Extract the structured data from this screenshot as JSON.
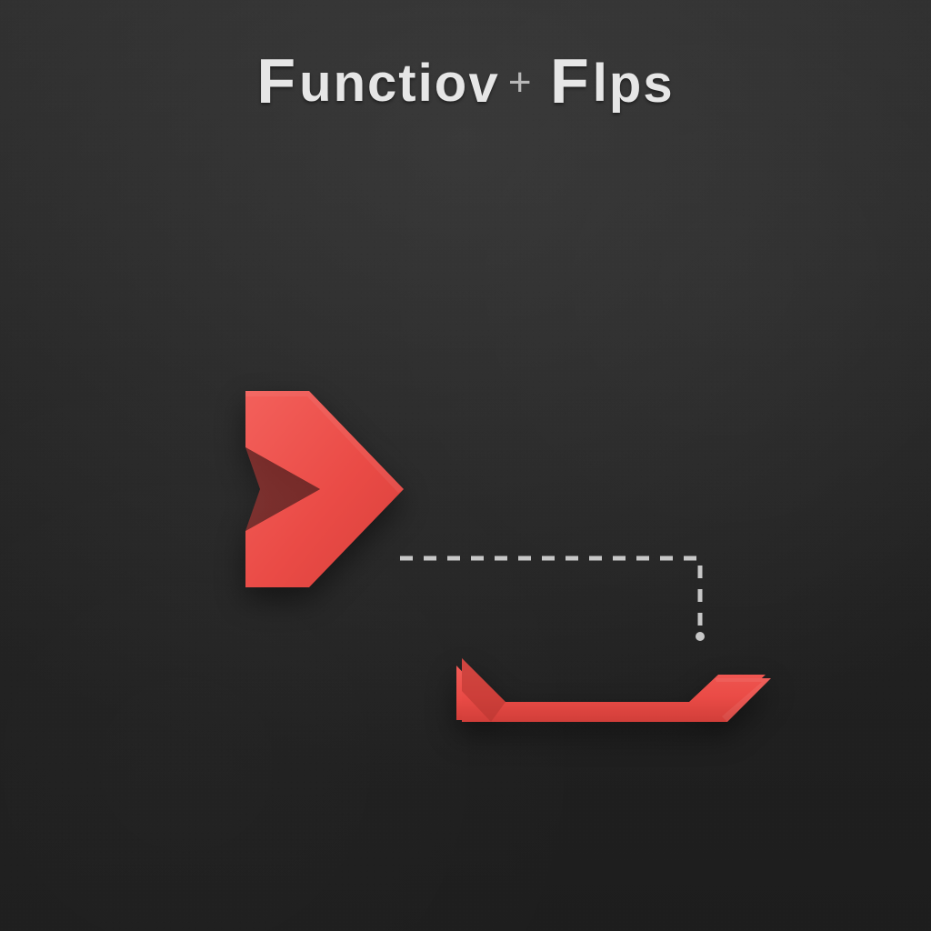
{
  "title": {
    "word1_rest": "unctio",
    "word1_tail": "v",
    "word2_rest": "l",
    "word2_tail": "ps"
  },
  "colors": {
    "accent": "#ea4b46",
    "accent_highlight": "#f3605b",
    "accent_shadow": "#c23b36",
    "connector": "#d9d9d9",
    "background": "#232323",
    "text": "#e6e6e6"
  },
  "icons": {
    "chevron": "chevron-right-icon",
    "corner": "corner-arrow-icon",
    "separator": "plus-separator-icon"
  }
}
